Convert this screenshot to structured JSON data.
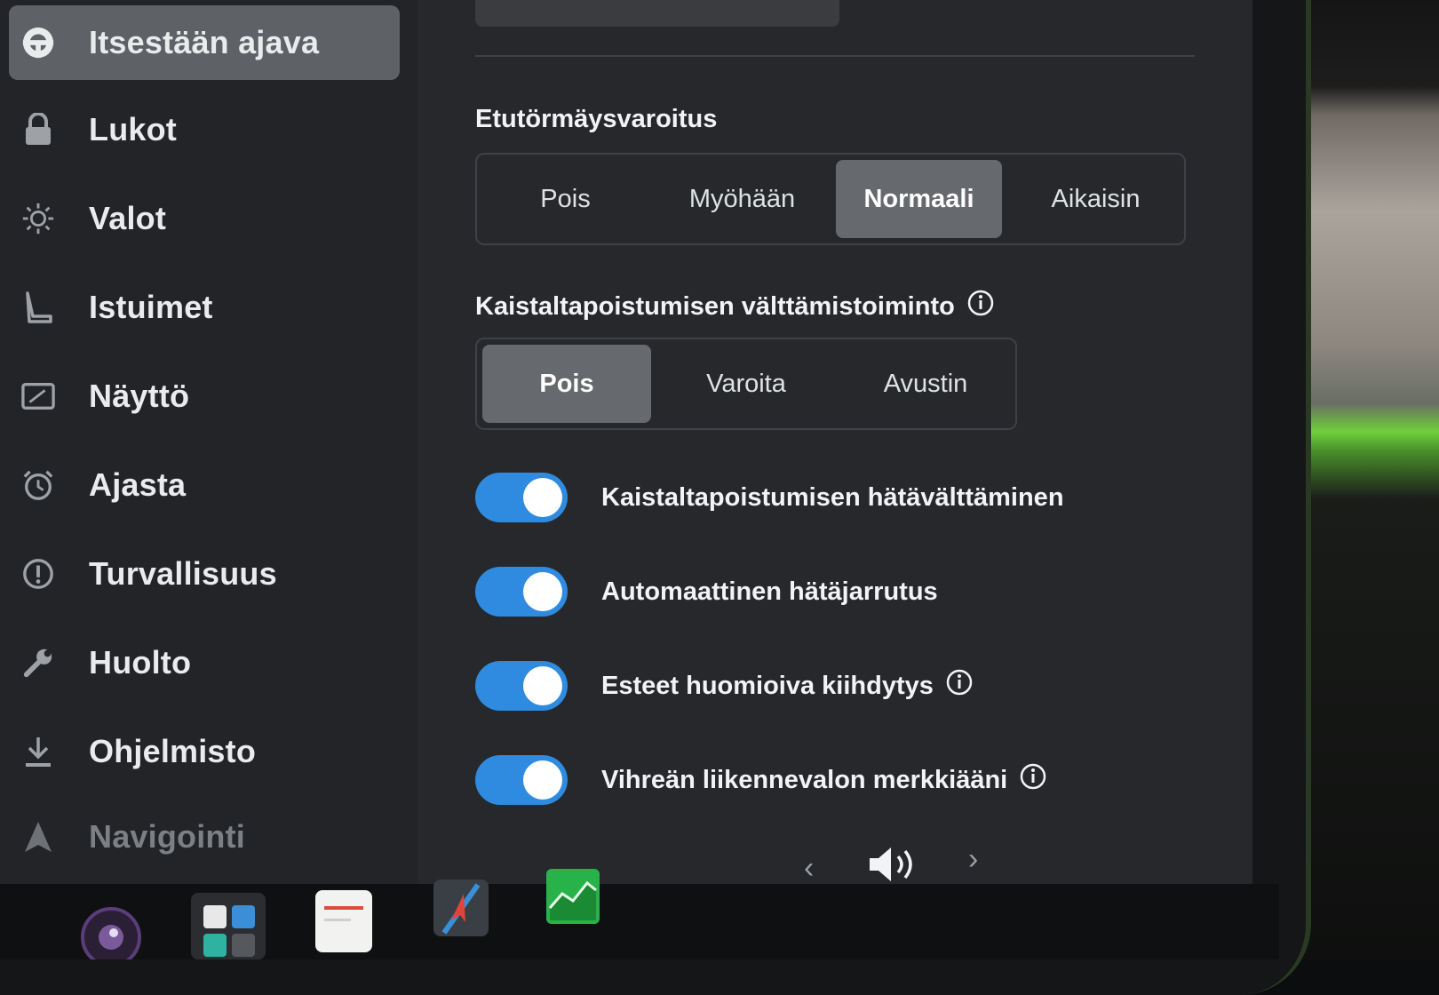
{
  "sidebar": {
    "items": [
      {
        "label": "Itsestään ajava",
        "icon": "steering-wheel-icon",
        "active": true
      },
      {
        "label": "Lukot",
        "icon": "lock-icon"
      },
      {
        "label": "Valot",
        "icon": "sun-icon"
      },
      {
        "label": "Istuimet",
        "icon": "seat-icon"
      },
      {
        "label": "Näyttö",
        "icon": "display-icon"
      },
      {
        "label": "Ajasta",
        "icon": "alarm-clock-icon"
      },
      {
        "label": "Turvallisuus",
        "icon": "safety-icon"
      },
      {
        "label": "Huolto",
        "icon": "wrench-icon"
      },
      {
        "label": "Ohjelmisto",
        "icon": "download-icon"
      },
      {
        "label": "Navigointi",
        "icon": "navigation-arrow-icon"
      }
    ]
  },
  "forward_collision": {
    "title": "Etutörmäysvaroitus",
    "options": [
      "Pois",
      "Myöhään",
      "Normaali",
      "Aikaisin"
    ],
    "selected": "Normaali"
  },
  "lane_departure": {
    "title": "Kaistaltapoistumisen välttämistoiminto",
    "options": [
      "Pois",
      "Varoita",
      "Avustin"
    ],
    "selected": "Pois"
  },
  "toggles": [
    {
      "label": "Kaistaltapoistumisen hätävälttäminen",
      "on": true,
      "info": false
    },
    {
      "label": "Automaattinen hätäjarrutus",
      "on": true,
      "info": false
    },
    {
      "label": "Esteet huomioiva kiihdytys",
      "on": true,
      "info": true
    },
    {
      "label": "Vihreän liikennevalon merkkiääni",
      "on": true,
      "info": true
    }
  ],
  "taskbar": {
    "prev": "‹",
    "next": "›",
    "icons": [
      "camera-icon",
      "app-launcher-icon",
      "notepad-icon",
      "navigation-app-icon",
      "stocks-chart-icon",
      "volume-icon"
    ]
  },
  "colors": {
    "toggle_on": "#2e8bdf",
    "selected_segment": "#66696d",
    "accent_green": "#2fbf4a"
  }
}
